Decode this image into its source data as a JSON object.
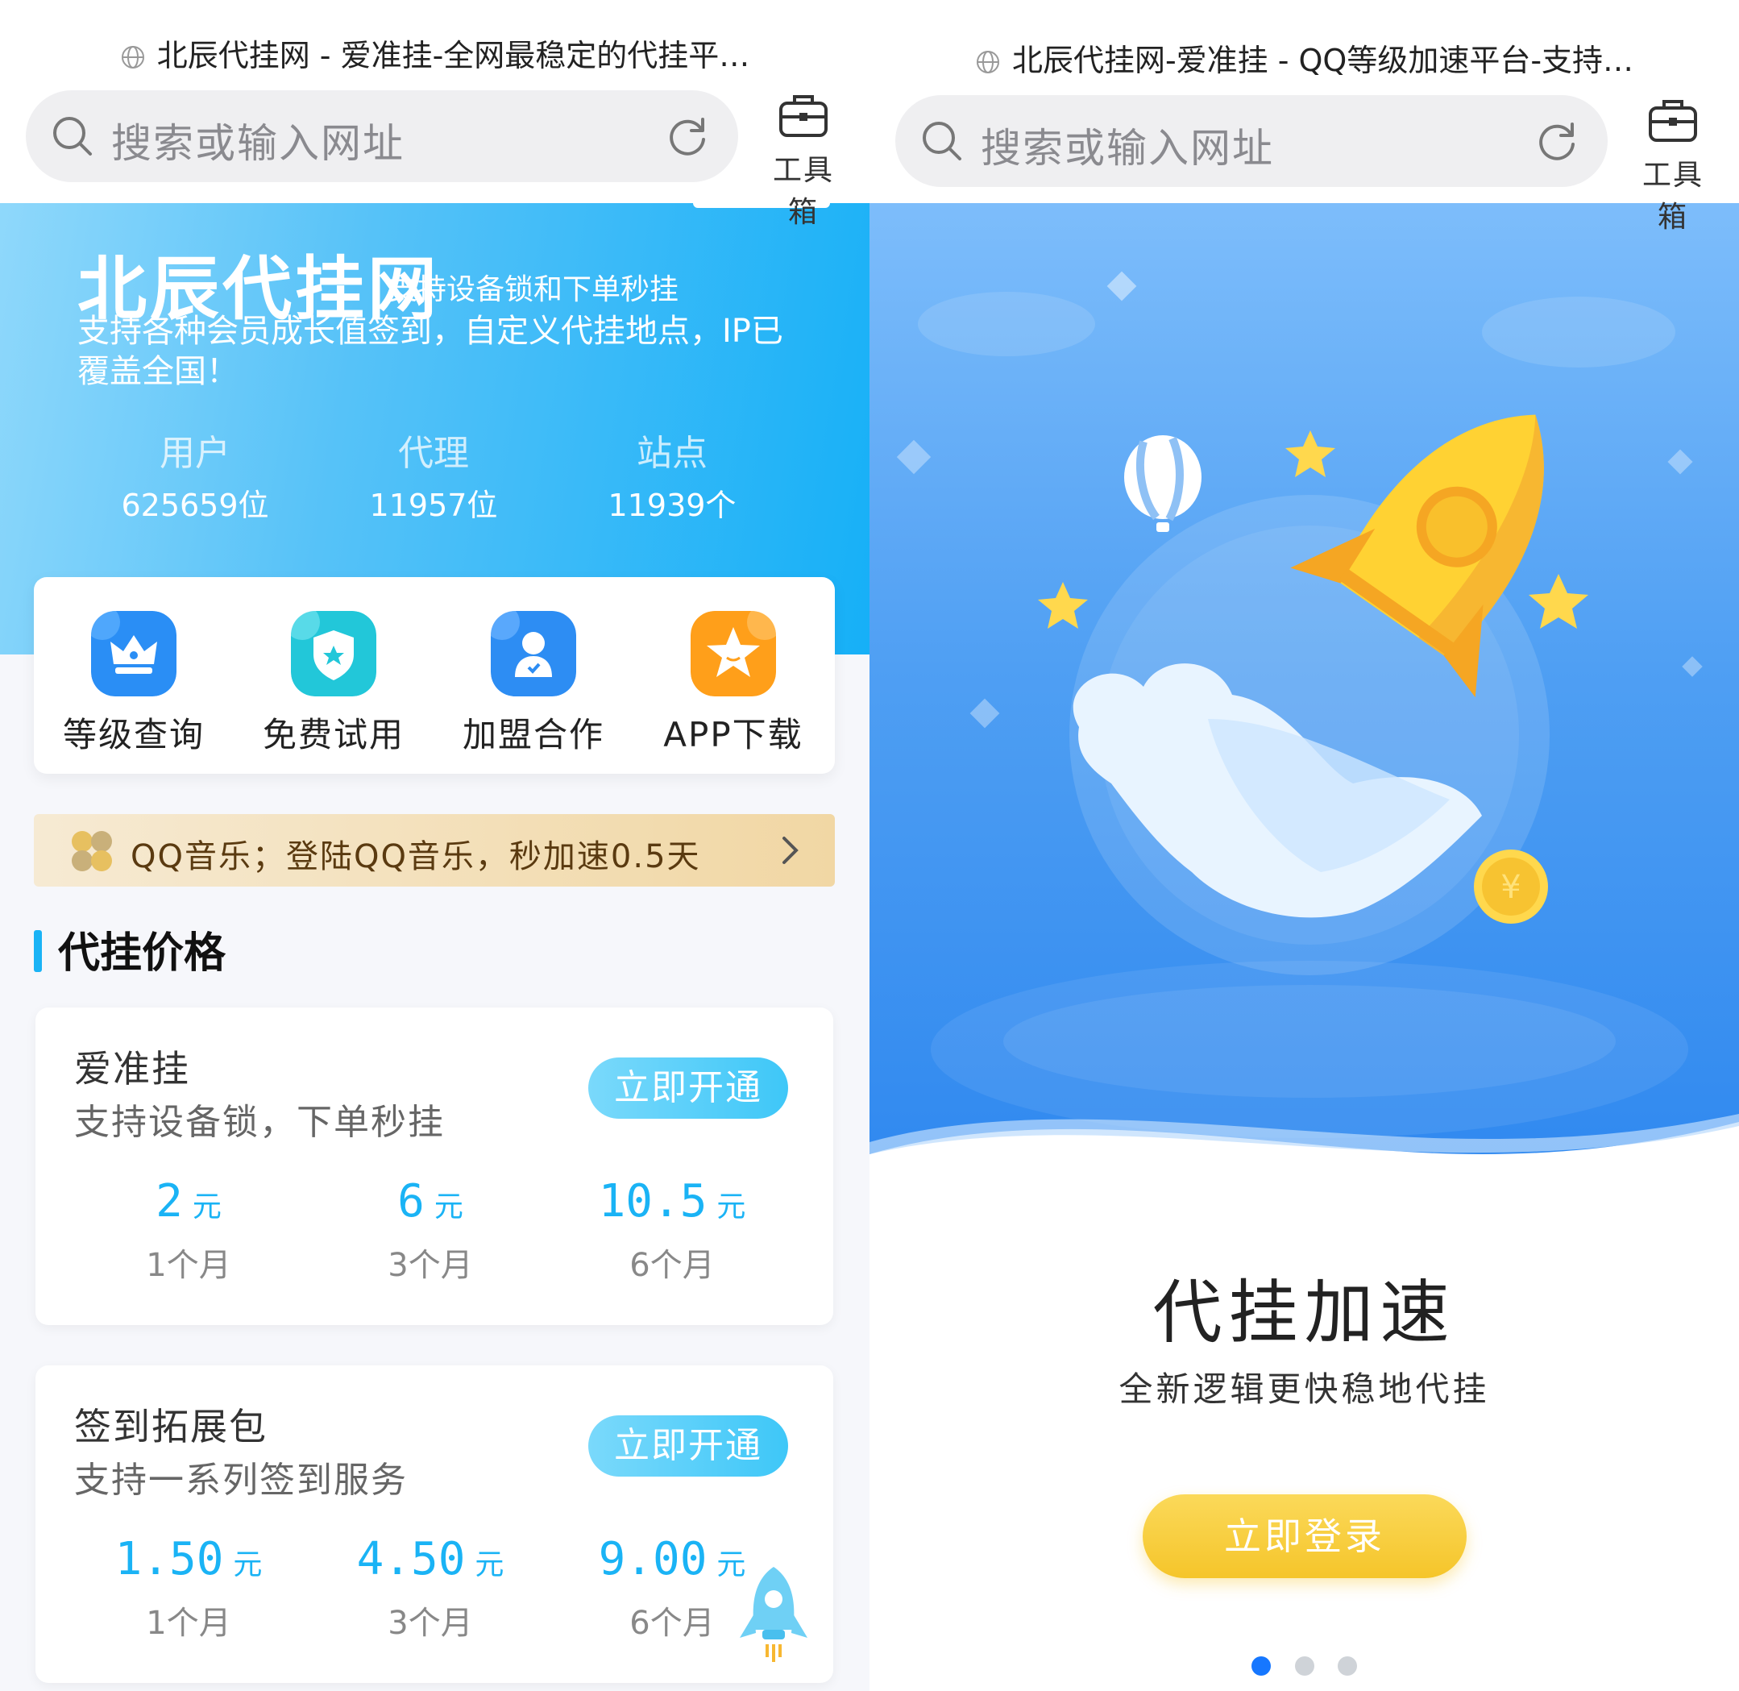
{
  "left": {
    "browser": {
      "page_title": "北辰代挂网 - 爱准挂-全网最稳定的代挂平…",
      "search_placeholder": "搜索或输入网址",
      "toolbox_label": "工具箱"
    },
    "hero": {
      "brand": "北辰代挂网",
      "tagline": "支持设备锁和下单秒挂",
      "description": "支持各种会员成长值签到，自定义代挂地点，IP已覆盖全国！",
      "stats": [
        {
          "label": "用户",
          "value": "625659位"
        },
        {
          "label": "代理",
          "value": "11957位"
        },
        {
          "label": "站点",
          "value": "11939个"
        }
      ]
    },
    "quick_menu": [
      {
        "label": "等级查询",
        "icon": "crown-icon",
        "color": "#2a8ef5"
      },
      {
        "label": "免费试用",
        "icon": "shield-star-icon",
        "color": "#22c7d9"
      },
      {
        "label": "加盟合作",
        "icon": "user-icon",
        "color": "#2d8df3"
      },
      {
        "label": "APP下载",
        "icon": "star-icon",
        "color": "#ff9f1a"
      }
    ],
    "notice": {
      "text": "QQ音乐；登陆QQ音乐，秒加速0.5天"
    },
    "section_title": "代挂价格",
    "cards": [
      {
        "name": "爱准挂",
        "subtitle": "支持设备锁，下单秒挂",
        "button": "立即开通",
        "prices": [
          {
            "amount": "2",
            "unit": "元",
            "period": "1个月"
          },
          {
            "amount": "6",
            "unit": "元",
            "period": "3个月"
          },
          {
            "amount": "10.5",
            "unit": "元",
            "period": "6个月"
          }
        ]
      },
      {
        "name": "签到拓展包",
        "subtitle": "支持一系列签到服务",
        "button": "立即开通",
        "prices": [
          {
            "amount": "1.50",
            "unit": "元",
            "period": "1个月"
          },
          {
            "amount": "4.50",
            "unit": "元",
            "period": "3个月"
          },
          {
            "amount": "9.00",
            "unit": "元",
            "period": "6个月"
          }
        ]
      }
    ]
  },
  "right": {
    "browser": {
      "page_title": "北辰代挂网-爱准挂 - QQ等级加速平台-支持…",
      "search_placeholder": "搜索或输入网址",
      "toolbox_label": "工具箱"
    },
    "title": "代挂加速",
    "subtitle": "全新逻辑更快稳地代挂",
    "login_button": "立即登录",
    "pager": {
      "total": 3,
      "active": 1
    }
  },
  "colors": {
    "accent": "#1ab3f5",
    "login_yellow": "#f5c52a",
    "pager_active": "#1677ff"
  }
}
